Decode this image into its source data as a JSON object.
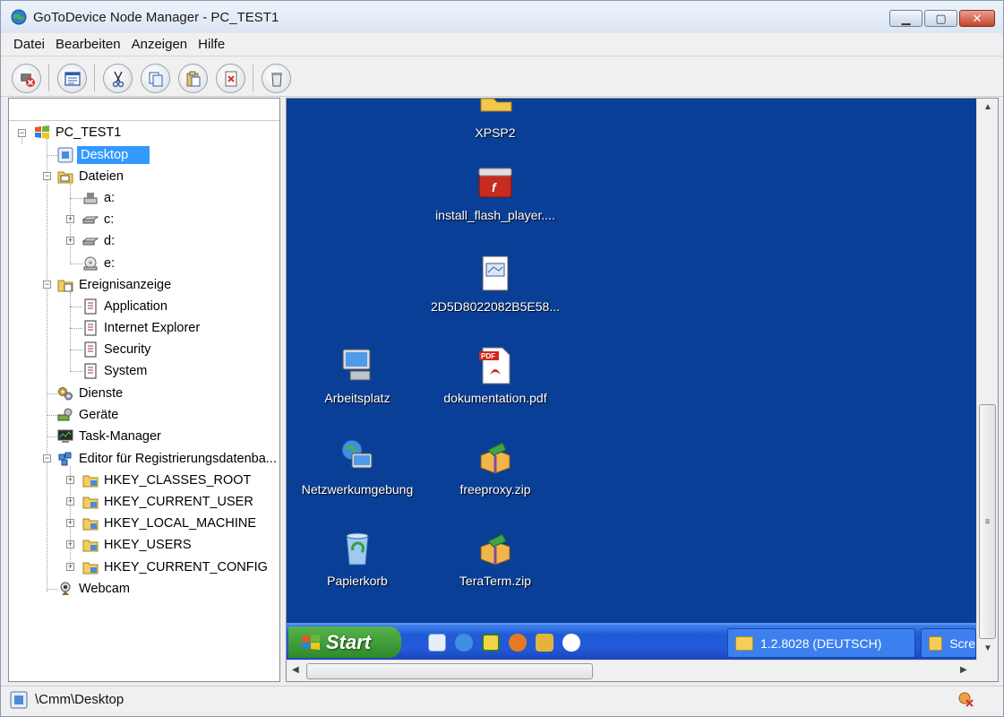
{
  "window": {
    "title": "GoToDevice Node Manager - PC_TEST1",
    "controls": {
      "minimize": "▁",
      "maximize": "▢",
      "close": "✕"
    }
  },
  "menu": [
    {
      "label": "Datei"
    },
    {
      "label": "Bearbeiten"
    },
    {
      "label": "Anzeigen"
    },
    {
      "label": "Hilfe"
    }
  ],
  "toolbar": {
    "icons": [
      "disconnect-icon",
      "properties-icon",
      "cut-icon",
      "copy-icon",
      "paste-icon",
      "delete-icon",
      "trash-icon"
    ]
  },
  "tree": {
    "root": "PC_TEST1",
    "desktop": "Desktop",
    "files": "Dateien",
    "drives": [
      "a:",
      "c:",
      "d:",
      "e:"
    ],
    "events": "Ereignisanzeige",
    "event_logs": [
      "Application",
      "Internet Explorer",
      "Security",
      "System"
    ],
    "services": "Dienste",
    "devices": "Geräte",
    "taskmanager": "Task-Manager",
    "registry": "Editor für Registrierungsdatenba...",
    "hkeys": [
      "HKEY_CLASSES_ROOT",
      "HKEY_CURRENT_USER",
      "HKEY_LOCAL_MACHINE",
      "HKEY_USERS",
      "HKEY_CURRENT_CONFIG"
    ],
    "webcam": "Webcam"
  },
  "desktop_icons": {
    "xpsp2": "XPSP2",
    "flash": "install_flash_player....",
    "file2d": "2D5D8022082B5E58...",
    "arbeitsplatz": "Arbeitsplatz",
    "dokumentation": "dokumentation.pdf",
    "netzwerk": "Netzwerkumgebung",
    "freeproxy": "freeproxy.zip",
    "papierkorb": "Papierkorb",
    "teraterm": "TeraTerm.zip"
  },
  "taskbar": {
    "start": "Start",
    "tasks": [
      "1.2.8028 (DEUTSCH)",
      "Scre"
    ]
  },
  "status": {
    "path": "\\Cmm\\Desktop"
  },
  "colors": {
    "desktop_bg": "#0a3f97",
    "selection": "#3399ff",
    "taskbar": "#2458d8",
    "start_green": "#3a9b33"
  }
}
